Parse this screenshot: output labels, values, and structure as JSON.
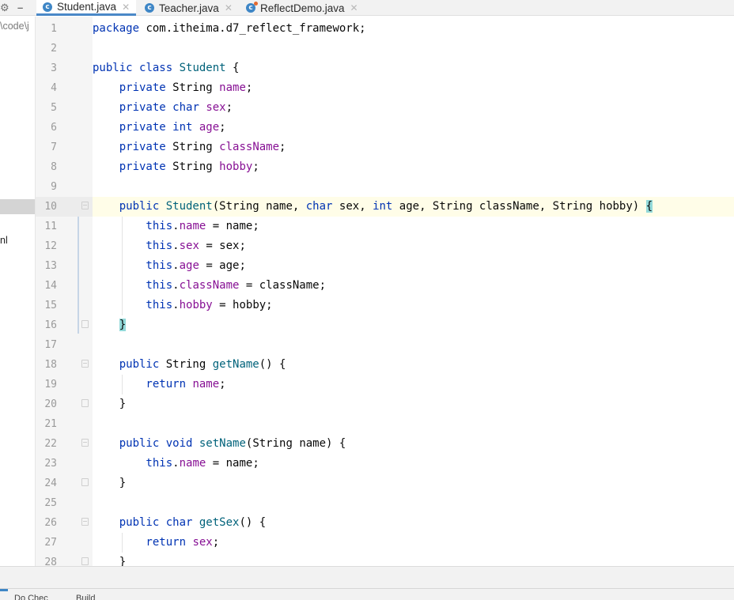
{
  "toolbar": {
    "settings_icon": "gear-icon",
    "minimize_icon": "minus-icon"
  },
  "tabs": [
    {
      "label": "Student.java",
      "active": true,
      "icon": "class-icon"
    },
    {
      "label": "Teacher.java",
      "active": false,
      "icon": "class-icon"
    },
    {
      "label": "ReflectDemo.java",
      "active": false,
      "icon": "class-main-icon"
    }
  ],
  "project_panel": {
    "path_fragment": "\\code\\j",
    "item_fragment": "nl"
  },
  "editor": {
    "current_line": 10,
    "lines": [
      {
        "no": "1",
        "tokens": [
          {
            "t": "package ",
            "c": "kw"
          },
          {
            "t": "com.itheima.d7_reflect_framework;",
            "c": ""
          }
        ]
      },
      {
        "no": "2",
        "tokens": []
      },
      {
        "no": "3",
        "tokens": [
          {
            "t": "public ",
            "c": "kw"
          },
          {
            "t": "class ",
            "c": "kw"
          },
          {
            "t": "Student",
            "c": "mth"
          },
          {
            "t": " {",
            "c": ""
          }
        ]
      },
      {
        "no": "4",
        "tokens": [
          {
            "t": "    private ",
            "c": "kw"
          },
          {
            "t": "String ",
            "c": ""
          },
          {
            "t": "name",
            "c": "fld"
          },
          {
            "t": ";",
            "c": ""
          }
        ]
      },
      {
        "no": "5",
        "tokens": [
          {
            "t": "    private ",
            "c": "kw"
          },
          {
            "t": "char ",
            "c": "kw"
          },
          {
            "t": "sex",
            "c": "fld"
          },
          {
            "t": ";",
            "c": ""
          }
        ]
      },
      {
        "no": "6",
        "tokens": [
          {
            "t": "    private ",
            "c": "kw"
          },
          {
            "t": "int ",
            "c": "kw"
          },
          {
            "t": "age",
            "c": "fld"
          },
          {
            "t": ";",
            "c": ""
          }
        ]
      },
      {
        "no": "7",
        "tokens": [
          {
            "t": "    private ",
            "c": "kw"
          },
          {
            "t": "String ",
            "c": ""
          },
          {
            "t": "className",
            "c": "fld"
          },
          {
            "t": ";",
            "c": ""
          }
        ]
      },
      {
        "no": "8",
        "tokens": [
          {
            "t": "    private ",
            "c": "kw"
          },
          {
            "t": "String ",
            "c": ""
          },
          {
            "t": "hobby",
            "c": "fld"
          },
          {
            "t": ";",
            "c": ""
          }
        ]
      },
      {
        "no": "9",
        "tokens": []
      },
      {
        "no": "10",
        "tokens": [
          {
            "t": "    public ",
            "c": "kw"
          },
          {
            "t": "Student",
            "c": "mth"
          },
          {
            "t": "(String name, ",
            "c": ""
          },
          {
            "t": "char ",
            "c": "kw"
          },
          {
            "t": "sex, ",
            "c": ""
          },
          {
            "t": "int ",
            "c": "kw"
          },
          {
            "t": "age, String className, String hobby) ",
            "c": ""
          },
          {
            "t": "{",
            "c": "brace"
          }
        ]
      },
      {
        "no": "11",
        "tokens": [
          {
            "t": "        this",
            "c": "kw"
          },
          {
            "t": ".",
            "c": ""
          },
          {
            "t": "name",
            "c": "fld"
          },
          {
            "t": " = name;",
            "c": ""
          }
        ]
      },
      {
        "no": "12",
        "tokens": [
          {
            "t": "        this",
            "c": "kw"
          },
          {
            "t": ".",
            "c": ""
          },
          {
            "t": "sex",
            "c": "fld"
          },
          {
            "t": " = sex;",
            "c": ""
          }
        ]
      },
      {
        "no": "13",
        "tokens": [
          {
            "t": "        this",
            "c": "kw"
          },
          {
            "t": ".",
            "c": ""
          },
          {
            "t": "age",
            "c": "fld"
          },
          {
            "t": " = age;",
            "c": ""
          }
        ]
      },
      {
        "no": "14",
        "tokens": [
          {
            "t": "        this",
            "c": "kw"
          },
          {
            "t": ".",
            "c": ""
          },
          {
            "t": "className",
            "c": "fld"
          },
          {
            "t": " = className;",
            "c": ""
          }
        ]
      },
      {
        "no": "15",
        "tokens": [
          {
            "t": "        this",
            "c": "kw"
          },
          {
            "t": ".",
            "c": ""
          },
          {
            "t": "hobby",
            "c": "fld"
          },
          {
            "t": " = hobby;",
            "c": ""
          }
        ]
      },
      {
        "no": "16",
        "tokens": [
          {
            "t": "    ",
            "c": ""
          },
          {
            "t": "}",
            "c": "brace"
          }
        ]
      },
      {
        "no": "17",
        "tokens": []
      },
      {
        "no": "18",
        "tokens": [
          {
            "t": "    public ",
            "c": "kw"
          },
          {
            "t": "String ",
            "c": ""
          },
          {
            "t": "getName",
            "c": "mth"
          },
          {
            "t": "() {",
            "c": ""
          }
        ]
      },
      {
        "no": "19",
        "tokens": [
          {
            "t": "        return ",
            "c": "kw"
          },
          {
            "t": "name",
            "c": "fld"
          },
          {
            "t": ";",
            "c": ""
          }
        ]
      },
      {
        "no": "20",
        "tokens": [
          {
            "t": "    }",
            "c": ""
          }
        ]
      },
      {
        "no": "21",
        "tokens": []
      },
      {
        "no": "22",
        "tokens": [
          {
            "t": "    public ",
            "c": "kw"
          },
          {
            "t": "void ",
            "c": "kw"
          },
          {
            "t": "setName",
            "c": "mth"
          },
          {
            "t": "(String name) {",
            "c": ""
          }
        ]
      },
      {
        "no": "23",
        "tokens": [
          {
            "t": "        this",
            "c": "kw"
          },
          {
            "t": ".",
            "c": ""
          },
          {
            "t": "name",
            "c": "fld"
          },
          {
            "t": " = name;",
            "c": ""
          }
        ]
      },
      {
        "no": "24",
        "tokens": [
          {
            "t": "    }",
            "c": ""
          }
        ]
      },
      {
        "no": "25",
        "tokens": []
      },
      {
        "no": "26",
        "tokens": [
          {
            "t": "    public ",
            "c": "kw"
          },
          {
            "t": "char ",
            "c": "kw"
          },
          {
            "t": "getSex",
            "c": "mth"
          },
          {
            "t": "() {",
            "c": ""
          }
        ]
      },
      {
        "no": "27",
        "tokens": [
          {
            "t": "        return ",
            "c": "kw"
          },
          {
            "t": "sex",
            "c": "fld"
          },
          {
            "t": ";",
            "c": ""
          }
        ]
      },
      {
        "no": "28",
        "tokens": [
          {
            "t": "    }",
            "c": ""
          }
        ]
      }
    ]
  },
  "statusbar": {
    "items": [
      "Do Chec",
      "Build"
    ]
  },
  "colors": {
    "keyword": "#0033b3",
    "field": "#871094",
    "method": "#00627a",
    "accent": "#4a88c7",
    "brace_highlight": "#93d9d9"
  }
}
